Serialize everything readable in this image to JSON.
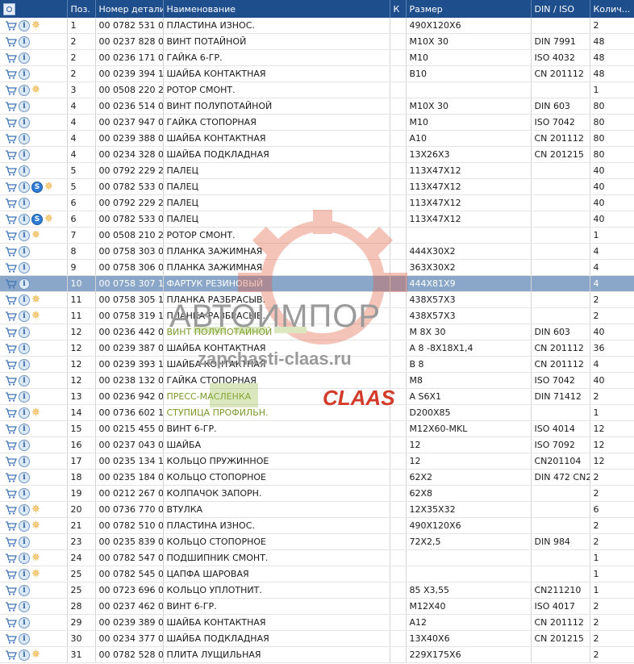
{
  "columns": {
    "icons": "",
    "pos": "Поз.",
    "part": "Номер детали",
    "name": "Наименование",
    "k": "К",
    "size": "Размер",
    "din": "DIN / ISO",
    "qty": "Колич..."
  },
  "rows": [
    {
      "pos": "1",
      "part": "00 0782 531 0",
      "name": "ПЛАСТИНА ИЗНОС.",
      "size": "490X120X6",
      "din": "",
      "qty": "2",
      "icons": [
        "cart",
        "info",
        "star"
      ]
    },
    {
      "pos": "2",
      "part": "00 0237 828 0",
      "name": "ВИНТ ПОТАЙНОЙ",
      "size": "M10X 30",
      "din": "DIN 7991",
      "qty": "48",
      "icons": [
        "cart",
        "info"
      ]
    },
    {
      "pos": "2",
      "part": "00 0236 171 0",
      "name": "ГАЙКА 6-ГР.",
      "size": "M10",
      "din": "ISO 4032",
      "qty": "48",
      "icons": [
        "cart",
        "info"
      ]
    },
    {
      "pos": "2",
      "part": "00 0239 394 1",
      "name": "ШАЙБА КОНТАКТНАЯ",
      "size": "B10",
      "din": "CN 201112",
      "qty": "48",
      "icons": [
        "cart",
        "info"
      ]
    },
    {
      "pos": "3",
      "part": "00 0508 220 2",
      "name": "РОТОР СМОНТ.",
      "size": "",
      "din": "",
      "qty": "1",
      "icons": [
        "cart",
        "info",
        "star"
      ]
    },
    {
      "pos": "4",
      "part": "00 0236 514 0",
      "name": "ВИНТ ПОЛУПОТАЙНОЙ",
      "size": "M10X 30",
      "din": "DIN 603",
      "qty": "80",
      "icons": [
        "cart",
        "info"
      ]
    },
    {
      "pos": "4",
      "part": "00 0237 947 0",
      "name": "ГАЙКА СТОПОРНАЯ",
      "size": "M10",
      "din": "ISO 7042",
      "qty": "80",
      "icons": [
        "cart",
        "info"
      ]
    },
    {
      "pos": "4",
      "part": "00 0239 388 0",
      "name": "ШАЙБА КОНТАКТНАЯ",
      "size": "A10",
      "din": "CN 201112",
      "qty": "80",
      "icons": [
        "cart",
        "info"
      ]
    },
    {
      "pos": "4",
      "part": "00 0234 328 0",
      "name": "ШАЙБА ПОДКЛАДНАЯ",
      "size": "13X26X3",
      "din": "CN 201215",
      "qty": "80",
      "icons": [
        "cart",
        "info"
      ]
    },
    {
      "pos": "5",
      "part": "00 0792 229 2",
      "name": "ПАЛЕЦ",
      "size": "113X47X12",
      "din": "",
      "qty": "40",
      "icons": [
        "cart",
        "info"
      ]
    },
    {
      "pos": "5",
      "part": "00 0782 533 0",
      "name": "ПАЛЕЦ",
      "size": "113X47X12",
      "din": "",
      "qty": "40",
      "icons": [
        "cart",
        "info",
        "s",
        "star"
      ]
    },
    {
      "pos": "6",
      "part": "00 0792 229 2",
      "name": "ПАЛЕЦ",
      "size": "113X47X12",
      "din": "",
      "qty": "40",
      "icons": [
        "cart",
        "info"
      ]
    },
    {
      "pos": "6",
      "part": "00 0782 533 0",
      "name": "ПАЛЕЦ",
      "size": "113X47X12",
      "din": "",
      "qty": "40",
      "icons": [
        "cart",
        "info",
        "s",
        "star"
      ]
    },
    {
      "pos": "7",
      "part": "00 0508 210 2",
      "name": "РОТОР СМОНТ.",
      "size": "",
      "din": "",
      "qty": "1",
      "icons": [
        "cart",
        "info",
        "star"
      ]
    },
    {
      "pos": "8",
      "part": "00 0758 303 0",
      "name": "ПЛАНКА ЗАЖИМНАЯ",
      "size": "444X30X2",
      "din": "",
      "qty": "4",
      "icons": [
        "cart",
        "info"
      ]
    },
    {
      "pos": "9",
      "part": "00 0758 306 0",
      "name": "ПЛАНКА ЗАЖИМНАЯ",
      "size": "363X30X2",
      "din": "",
      "qty": "4",
      "icons": [
        "cart",
        "info"
      ]
    },
    {
      "pos": "10",
      "part": "00 0758 307 1",
      "name": "ФАРТУК РЕЗИНОВЫЙ",
      "size": "444X81X9",
      "din": "",
      "qty": "4",
      "icons": [
        "cart",
        "info"
      ],
      "selected": true
    },
    {
      "pos": "11",
      "part": "00 0758 305 1",
      "name": "ПЛАНКА РАЗБРАСЫВ.",
      "size": "438X57X3",
      "din": "",
      "qty": "2",
      "icons": [
        "cart",
        "info",
        "star"
      ]
    },
    {
      "pos": "11",
      "part": "00 0758 319 1",
      "name": "ПЛАНКА РАЗБРАСЫВ.",
      "size": "438X57X3",
      "din": "",
      "qty": "2",
      "icons": [
        "cart",
        "info",
        "star"
      ]
    },
    {
      "pos": "12",
      "part": "00 0236 442 0",
      "name": "ВИНТ ПОЛУПОТАЙНОЙ",
      "size": "M 8X 30",
      "din": "DIN 603",
      "qty": "40",
      "icons": [
        "cart",
        "info"
      ],
      "hl": true
    },
    {
      "pos": "12",
      "part": "00 0239 387 0",
      "name": "ШАЙБА КОНТАКТНАЯ",
      "size": "A 8 -8X18X1,4",
      "din": "CN 201112",
      "qty": "36",
      "icons": [
        "cart",
        "info"
      ]
    },
    {
      "pos": "12",
      "part": "00 0239 393 1",
      "name": "ШАЙБА КОНТАКТНАЯ",
      "size": "B 8",
      "din": "CN 201112",
      "qty": "4",
      "icons": [
        "cart",
        "info"
      ]
    },
    {
      "pos": "12",
      "part": "00 0238 132 0",
      "name": "ГАЙКА СТОПОРНАЯ",
      "size": "M8",
      "din": "ISO 7042",
      "qty": "40",
      "icons": [
        "cart",
        "info"
      ]
    },
    {
      "pos": "13",
      "part": "00 0236 942 0",
      "name": "ПРЕСС-МАСЛЕНКА",
      "size": "A S6X1",
      "din": "DIN 71412",
      "qty": "2",
      "icons": [
        "cart",
        "info"
      ],
      "hl": true
    },
    {
      "pos": "14",
      "part": "00 0736 602 1",
      "name": "СТУПИЦА ПРОФИЛЬН.",
      "size": "D200X85",
      "din": "",
      "qty": "1",
      "icons": [
        "cart",
        "info",
        "star"
      ],
      "hl": true
    },
    {
      "pos": "15",
      "part": "00 0215 455 0",
      "name": "ВИНТ 6-ГР.",
      "size": "M12X60-MKL",
      "din": "ISO 4014",
      "qty": "12",
      "icons": [
        "cart",
        "info"
      ]
    },
    {
      "pos": "16",
      "part": "00 0237 043 0",
      "name": "ШАЙБА",
      "size": "12",
      "din": "ISO 7092",
      "qty": "12",
      "icons": [
        "cart",
        "info"
      ]
    },
    {
      "pos": "17",
      "part": "00 0235 134 1",
      "name": "КОЛЬЦО ПРУЖИННОЕ",
      "size": "12",
      "din": "CN201104",
      "qty": "12",
      "icons": [
        "cart",
        "info"
      ]
    },
    {
      "pos": "18",
      "part": "00 0235 184 0",
      "name": "КОЛЬЦО СТОПОРНОЕ",
      "size": "62X2",
      "din": "DIN 472 CN2",
      "qty": "2",
      "icons": [
        "cart",
        "info"
      ]
    },
    {
      "pos": "19",
      "part": "00 0212 267 0",
      "name": "КОЛПАЧОК ЗАПОРН.",
      "size": "62X8",
      "din": "",
      "qty": "2",
      "icons": [
        "cart",
        "info"
      ]
    },
    {
      "pos": "20",
      "part": "00 0736 770 0",
      "name": "ВТУЛКА",
      "size": "12X35X32",
      "din": "",
      "qty": "6",
      "icons": [
        "cart",
        "info",
        "star"
      ]
    },
    {
      "pos": "21",
      "part": "00 0782 510 0",
      "name": "ПЛАСТИНА ИЗНОС.",
      "size": "490X120X6",
      "din": "",
      "qty": "2",
      "icons": [
        "cart",
        "info",
        "star"
      ]
    },
    {
      "pos": "23",
      "part": "00 0235 839 0",
      "name": "КОЛЬЦО СТОПОРНОЕ",
      "size": "72X2,5",
      "din": "DIN 984",
      "qty": "2",
      "icons": [
        "cart",
        "info"
      ]
    },
    {
      "pos": "24",
      "part": "00 0782 547 0",
      "name": "ПОДШИПНИК СМОНТ.",
      "size": "",
      "din": "",
      "qty": "1",
      "icons": [
        "cart",
        "info",
        "star"
      ]
    },
    {
      "pos": "25",
      "part": "00 0782 545 0",
      "name": "ЦАПФА ШАРОВАЯ",
      "size": "",
      "din": "",
      "qty": "1",
      "icons": [
        "cart",
        "info",
        "star"
      ]
    },
    {
      "pos": "25",
      "part": "00 0723 696 0",
      "name": "КОЛЬЦО УПЛОТНИТ.",
      "size": "85   X3,55",
      "din": "CN211210",
      "qty": "1",
      "icons": [
        "cart",
        "info"
      ]
    },
    {
      "pos": "28",
      "part": "00 0237 462 0",
      "name": "ВИНТ 6-ГР.",
      "size": "M12X40",
      "din": "ISO 4017",
      "qty": "2",
      "icons": [
        "cart",
        "info"
      ]
    },
    {
      "pos": "29",
      "part": "00 0239 389 0",
      "name": "ШАЙБА КОНТАКТНАЯ",
      "size": "A12",
      "din": "CN 201112",
      "qty": "2",
      "icons": [
        "cart",
        "info"
      ]
    },
    {
      "pos": "30",
      "part": "00 0234 377 0",
      "name": "ШАЙБА ПОДКЛАДНАЯ",
      "size": "13X40X6",
      "din": "CN 201215",
      "qty": "2",
      "icons": [
        "cart",
        "info"
      ]
    },
    {
      "pos": "31",
      "part": "00 0782 528 0",
      "name": "ПЛИТА ЛУЩИЛЬНАЯ",
      "size": "229X175X6",
      "din": "",
      "qty": "2",
      "icons": [
        "cart",
        "info",
        "star"
      ]
    }
  ],
  "watermark": {
    "line1": "АВТОИМПОР",
    "line2": "zapchasti-claas.ru",
    "line3": "CLAAS"
  },
  "colors": {
    "header_bg": "#1f4e8c",
    "selected_bg": "#8aa6c8",
    "highlight_text": "#7a9a2a",
    "watermark_red": "#d23a2a"
  }
}
